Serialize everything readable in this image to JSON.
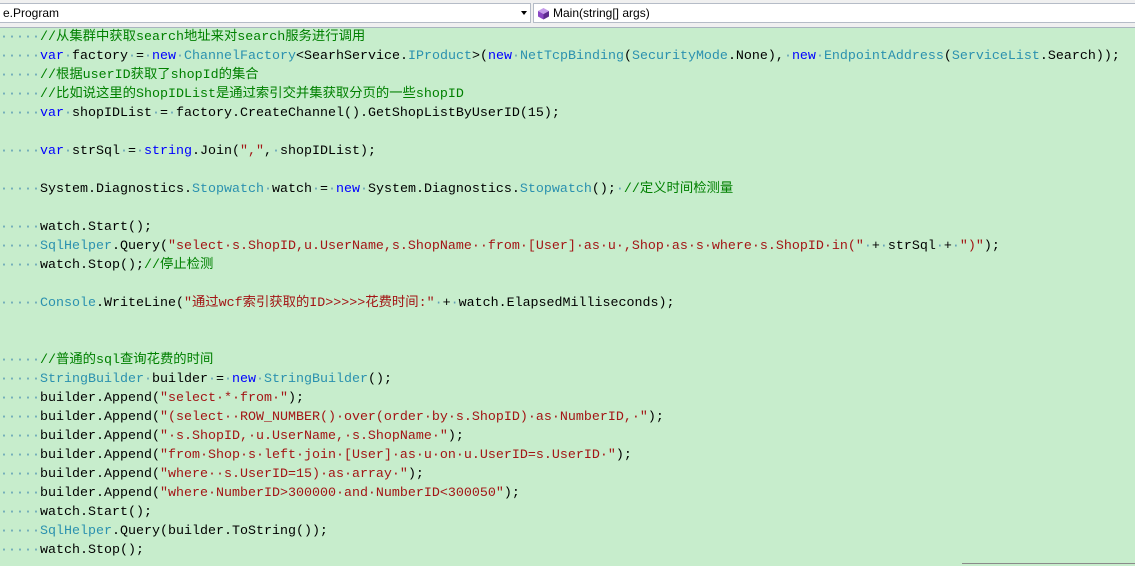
{
  "navigation_bar": {
    "type_selector": {
      "value": "e.Program",
      "icon": "chevron-down-icon"
    },
    "member_selector": {
      "value": "Main(string[] args)",
      "icon": "method-icon"
    }
  },
  "editor": {
    "colors": {
      "background": "#C7EDCC",
      "keyword": "#0000FF",
      "type": "#2B91AF",
      "string": "#A31515",
      "comment": "#008000",
      "plain": "#000000",
      "whitespace": "#5D9DB5"
    },
    "lines": [
      [
        {
          "ws": "·····"
        },
        {
          "cm": "//从集群中获取search地址来对search服务进行调用"
        }
      ],
      [
        {
          "ws": "·····"
        },
        {
          "kw": "var"
        },
        {
          "ws": "·"
        },
        {
          "pl": "factory"
        },
        {
          "ws": "·"
        },
        {
          "pl": "="
        },
        {
          "ws": "·"
        },
        {
          "kw": "new"
        },
        {
          "ws": "·"
        },
        {
          "type": "ChannelFactory"
        },
        {
          "pl": "<SearhService."
        },
        {
          "type": "IProduct"
        },
        {
          "pl": ">("
        },
        {
          "kw": "new"
        },
        {
          "ws": "·"
        },
        {
          "type": "NetTcpBinding"
        },
        {
          "pl": "("
        },
        {
          "type": "SecurityMode"
        },
        {
          "pl": ".None),"
        },
        {
          "ws": "·"
        },
        {
          "kw": "new"
        },
        {
          "ws": "·"
        },
        {
          "type": "EndpointAddress"
        },
        {
          "pl": "("
        },
        {
          "type": "ServiceList"
        },
        {
          "pl": ".Search));"
        }
      ],
      [
        {
          "ws": "·····"
        },
        {
          "cm": "//根据userID获取了shopId的集合"
        }
      ],
      [
        {
          "ws": "·····"
        },
        {
          "cm": "//比如说这里的ShopIDList是通过索引交并集获取分页的一些shopID"
        }
      ],
      [
        {
          "ws": "·····"
        },
        {
          "kw": "var"
        },
        {
          "ws": "·"
        },
        {
          "pl": "shopIDList"
        },
        {
          "ws": "·"
        },
        {
          "pl": "="
        },
        {
          "ws": "·"
        },
        {
          "pl": "factory.CreateChannel().GetShopListByUserID(15);"
        }
      ],
      [],
      [
        {
          "ws": "·····"
        },
        {
          "kw": "var"
        },
        {
          "ws": "·"
        },
        {
          "pl": "strSql"
        },
        {
          "ws": "·"
        },
        {
          "pl": "="
        },
        {
          "ws": "·"
        },
        {
          "kw": "string"
        },
        {
          "pl": ".Join("
        },
        {
          "str": "\",\""
        },
        {
          "pl": ","
        },
        {
          "ws": "·"
        },
        {
          "pl": "shopIDList);"
        }
      ],
      [],
      [
        {
          "ws": "·····"
        },
        {
          "pl": "System.Diagnostics."
        },
        {
          "type": "Stopwatch"
        },
        {
          "ws": "·"
        },
        {
          "pl": "watch"
        },
        {
          "ws": "·"
        },
        {
          "pl": "="
        },
        {
          "ws": "·"
        },
        {
          "kw": "new"
        },
        {
          "ws": "·"
        },
        {
          "pl": "System.Diagnostics."
        },
        {
          "type": "Stopwatch"
        },
        {
          "pl": "();"
        },
        {
          "ws": "·"
        },
        {
          "cm": "//定义时间检测量"
        }
      ],
      [],
      [
        {
          "ws": "·····"
        },
        {
          "pl": "watch.Start();"
        }
      ],
      [
        {
          "ws": "·····"
        },
        {
          "type": "SqlHelper"
        },
        {
          "pl": ".Query("
        },
        {
          "str": "\"select·s.ShopID,u.UserName,s.ShopName··from·[User]·as·u·,Shop·as·s·where·s.ShopID·in(\""
        },
        {
          "ws": "·"
        },
        {
          "pl": "+"
        },
        {
          "ws": "·"
        },
        {
          "pl": "strSql"
        },
        {
          "ws": "·"
        },
        {
          "pl": "+"
        },
        {
          "ws": "·"
        },
        {
          "str": "\")\""
        },
        {
          "pl": ");"
        }
      ],
      [
        {
          "ws": "·····"
        },
        {
          "pl": "watch.Stop();"
        },
        {
          "cm": "//停止检测"
        }
      ],
      [],
      [
        {
          "ws": "·····"
        },
        {
          "type": "Console"
        },
        {
          "pl": ".WriteLine("
        },
        {
          "str": "\"通过wcf索引获取的ID>>>>>花费时间:\""
        },
        {
          "ws": "·"
        },
        {
          "pl": "+"
        },
        {
          "ws": "·"
        },
        {
          "pl": "watch.ElapsedMilliseconds);"
        }
      ],
      [],
      [],
      [
        {
          "ws": "·····"
        },
        {
          "cm": "//普通的sql查询花费的时间"
        }
      ],
      [
        {
          "ws": "·····"
        },
        {
          "type": "StringBuilder"
        },
        {
          "ws": "·"
        },
        {
          "pl": "builder"
        },
        {
          "ws": "·"
        },
        {
          "pl": "="
        },
        {
          "ws": "·"
        },
        {
          "kw": "new"
        },
        {
          "ws": "·"
        },
        {
          "type": "StringBuilder"
        },
        {
          "pl": "();"
        }
      ],
      [
        {
          "ws": "·····"
        },
        {
          "pl": "builder.Append("
        },
        {
          "str": "\"select·*·from·\""
        },
        {
          "pl": ");"
        }
      ],
      [
        {
          "ws": "·····"
        },
        {
          "pl": "builder.Append("
        },
        {
          "str": "\"(select··ROW_NUMBER()·over(order·by·s.ShopID)·as·NumberID,·\""
        },
        {
          "pl": ");"
        }
      ],
      [
        {
          "ws": "·····"
        },
        {
          "pl": "builder.Append("
        },
        {
          "str": "\"·s.ShopID,·u.UserName,·s.ShopName·\""
        },
        {
          "pl": ");"
        }
      ],
      [
        {
          "ws": "·····"
        },
        {
          "pl": "builder.Append("
        },
        {
          "str": "\"from·Shop·s·left·join·[User]·as·u·on·u.UserID=s.UserID·\""
        },
        {
          "pl": ");"
        }
      ],
      [
        {
          "ws": "·····"
        },
        {
          "pl": "builder.Append("
        },
        {
          "str": "\"where··s.UserID=15)·as·array·\""
        },
        {
          "pl": ");"
        }
      ],
      [
        {
          "ws": "·····"
        },
        {
          "pl": "builder.Append("
        },
        {
          "str": "\"where·NumberID>300000·and·NumberID<300050\""
        },
        {
          "pl": ");"
        }
      ],
      [
        {
          "ws": "·····"
        },
        {
          "pl": "watch.Start();"
        }
      ],
      [
        {
          "ws": "·····"
        },
        {
          "type": "SqlHelper"
        },
        {
          "pl": ".Query(builder.ToString());"
        }
      ],
      [
        {
          "ws": "·····"
        },
        {
          "pl": "watch.Stop();"
        }
      ]
    ]
  }
}
